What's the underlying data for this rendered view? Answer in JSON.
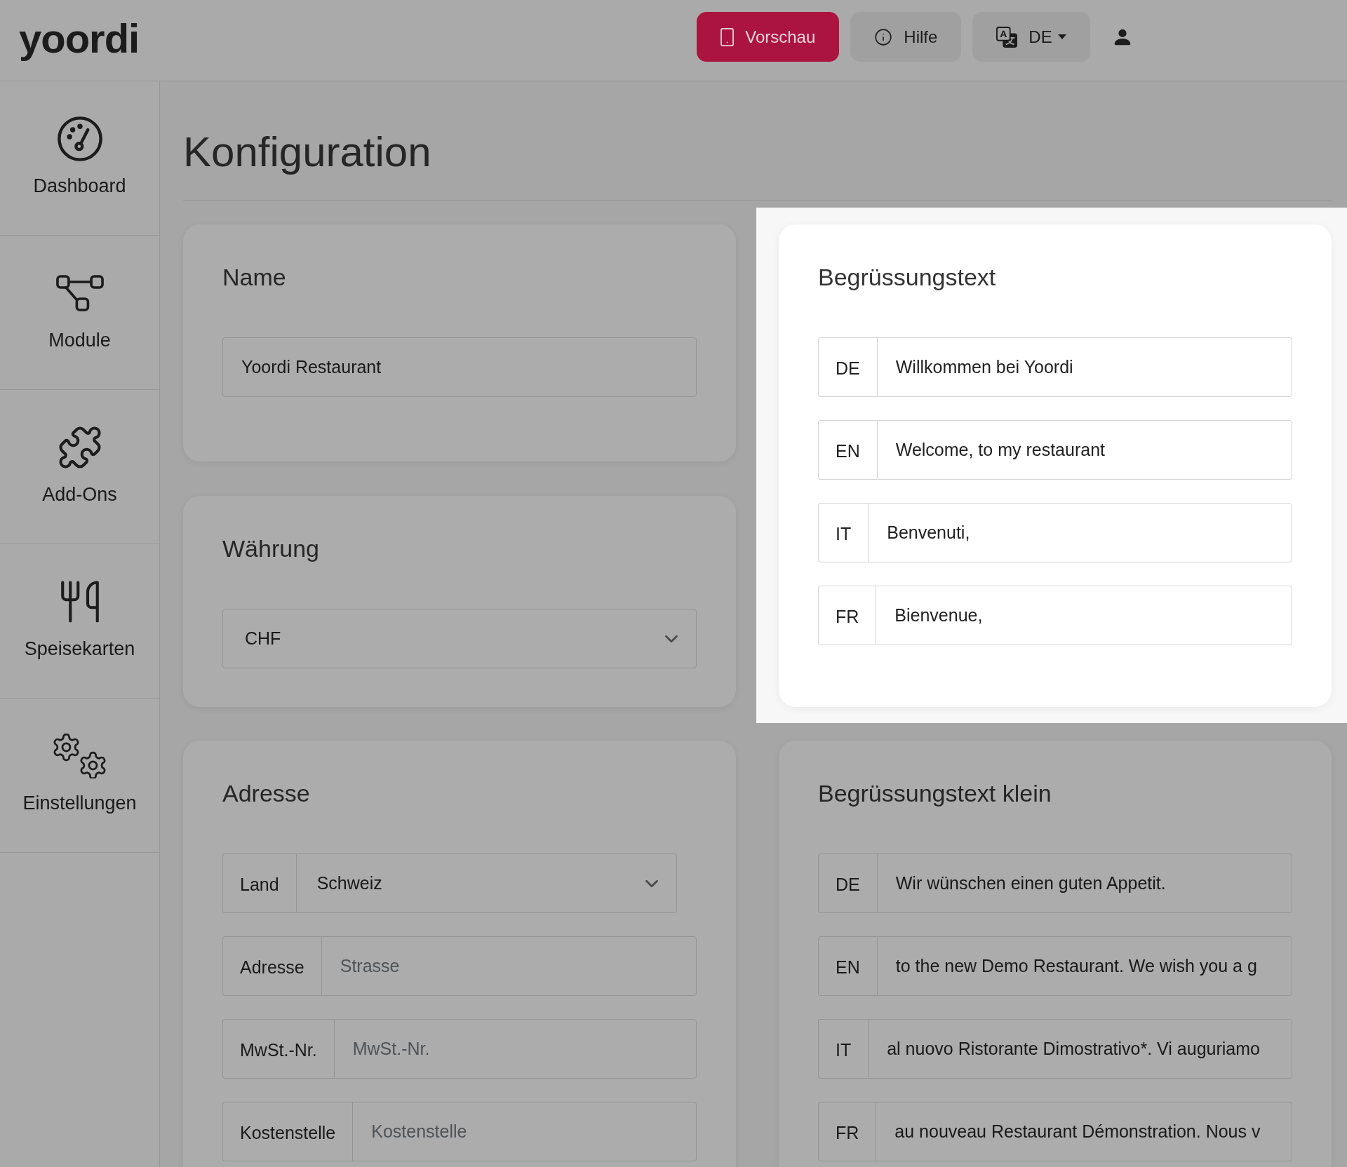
{
  "header": {
    "logo": "yoordi",
    "buttons": [
      {
        "kind": "primary",
        "label": "Vorschau"
      },
      {
        "kind": "secondary",
        "label": "Hilfe"
      },
      {
        "kind": "dropdown",
        "label": "DE"
      }
    ]
  },
  "sidebar": {
    "items": [
      {
        "label": "Dashboard"
      },
      {
        "label": "Module"
      },
      {
        "label": "Add-Ons"
      },
      {
        "label": "Speisekarten"
      },
      {
        "label": "Einstellungen"
      }
    ]
  },
  "page": {
    "title": "Konfiguration"
  },
  "rows": [
    {
      "columns": [
        {
          "cards": [
            {
              "title": "Name",
              "highlighted": false,
              "fields": [
                {
                  "kind": "text",
                  "value": "Yoordi Restaurant"
                }
              ]
            },
            {
              "title": "Währung",
              "highlighted": false,
              "fields": [
                {
                  "kind": "select",
                  "value": "CHF"
                }
              ]
            }
          ]
        },
        {
          "cards": [
            {
              "title": "Begrüssungstext",
              "highlighted": true,
              "fields": [
                {
                  "kind": "text",
                  "label": "DE",
                  "value": "Willkommen bei Yoordi"
                },
                {
                  "kind": "text",
                  "label": "EN",
                  "value": "Welcome, to my restaurant"
                },
                {
                  "kind": "text",
                  "label": "IT",
                  "value": "Benvenuti,"
                },
                {
                  "kind": "text",
                  "label": "FR",
                  "value": "Bienvenue,"
                }
              ]
            }
          ]
        }
      ]
    },
    {
      "columns": [
        {
          "cards": [
            {
              "title": "Adresse",
              "highlighted": false,
              "fields": [
                {
                  "kind": "select",
                  "label": "Land",
                  "value": "Schweiz"
                },
                {
                  "kind": "text",
                  "label": "Adresse",
                  "placeholder": "Strasse"
                },
                {
                  "kind": "text",
                  "label": "MwSt.-Nr.",
                  "placeholder": "MwSt.-Nr."
                },
                {
                  "kind": "text",
                  "label": "Kostenstelle",
                  "placeholder": "Kostenstelle"
                }
              ]
            }
          ]
        },
        {
          "cards": [
            {
              "title": "Begrüssungstext klein",
              "highlighted": false,
              "fields": [
                {
                  "kind": "text",
                  "label": "DE",
                  "value": "Wir wünschen einen guten Appetit."
                },
                {
                  "kind": "text",
                  "label": "EN",
                  "value": "to the new Demo Restaurant. We wish you a g"
                },
                {
                  "kind": "text",
                  "label": "IT",
                  "value": "al nuovo Ristorante Dimostrativo*. Vi auguriamo"
                },
                {
                  "kind": "text",
                  "label": "FR",
                  "value": "au nouveau Restaurant Démonstration. Nous v"
                }
              ]
            }
          ]
        }
      ]
    }
  ]
}
